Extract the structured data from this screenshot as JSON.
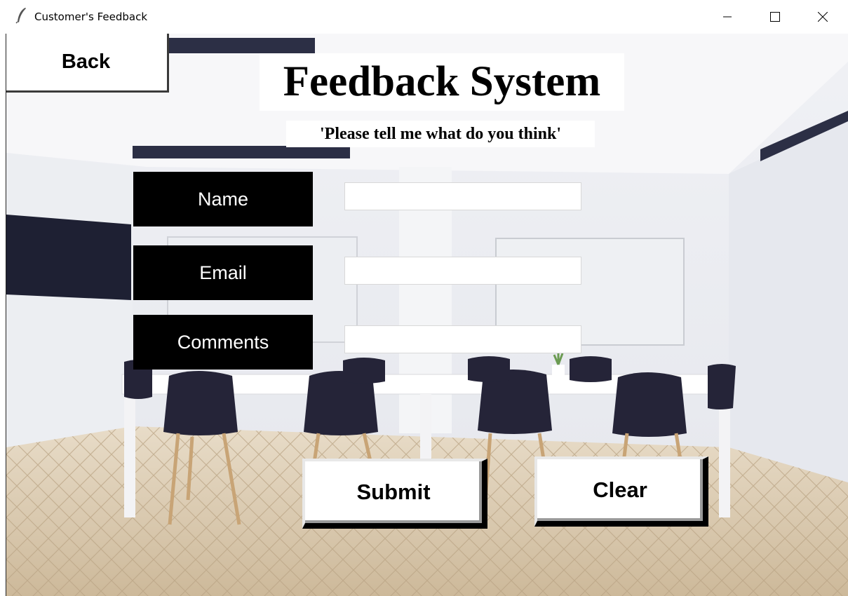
{
  "window": {
    "title": "Customer's Feedback",
    "controls": {
      "minimize": "minimize-icon",
      "maximize": "maximize-icon",
      "close": "close-icon"
    }
  },
  "header": {
    "back_label": "Back",
    "title": "Feedback System",
    "subtitle": "'Please tell me what do you think'"
  },
  "form": {
    "fields": [
      {
        "label": "Name",
        "value": ""
      },
      {
        "label": "Email",
        "value": ""
      },
      {
        "label": "Comments",
        "value": ""
      }
    ]
  },
  "actions": {
    "submit_label": "Submit",
    "clear_label": "Clear"
  },
  "colors": {
    "label_bg": "#000000",
    "label_text": "#ffffff",
    "button_bg": "#ffffff"
  }
}
